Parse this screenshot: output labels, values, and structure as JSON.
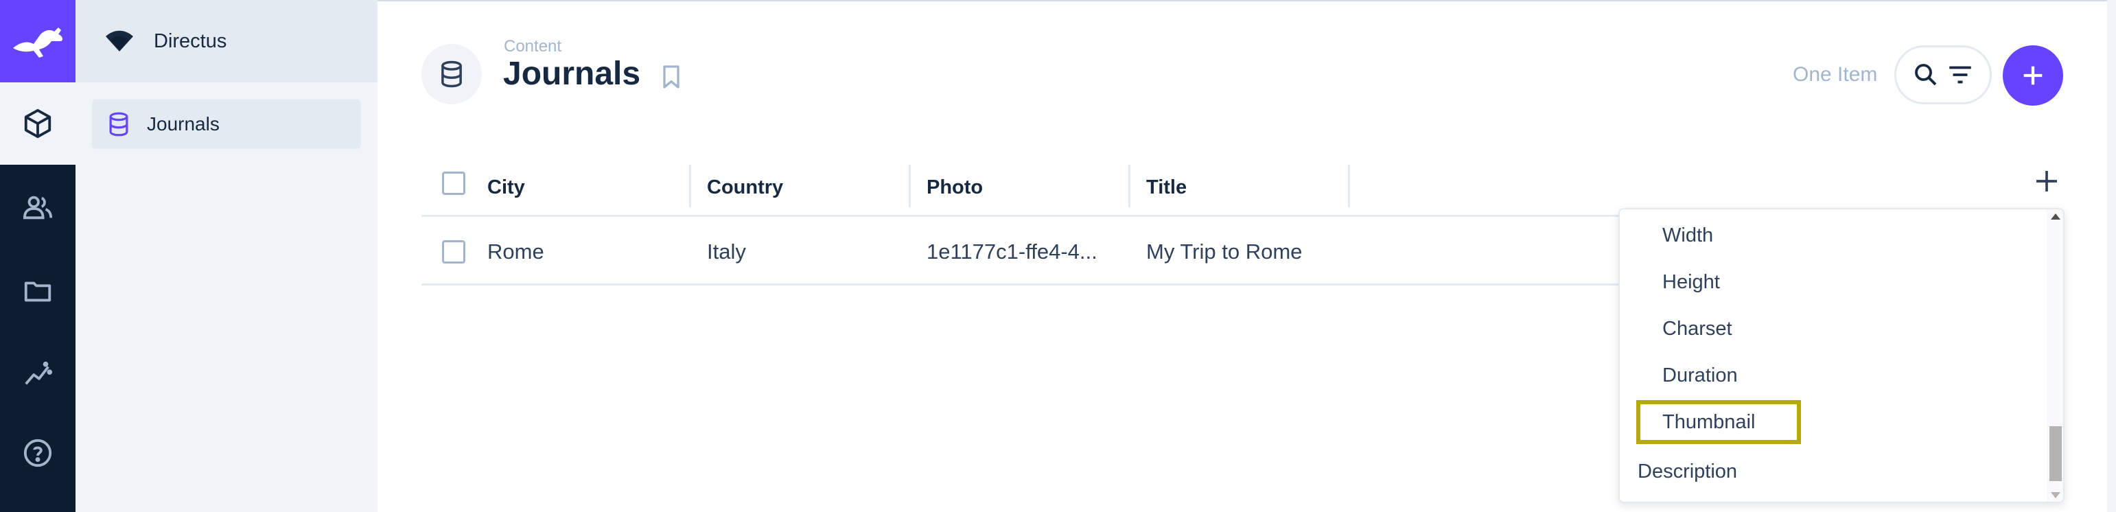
{
  "module_bar": {
    "items": [
      {
        "icon": "cube-icon",
        "active": true
      },
      {
        "icon": "users-icon",
        "active": false
      },
      {
        "icon": "folder-icon",
        "active": false
      },
      {
        "icon": "insights-icon",
        "active": false
      },
      {
        "icon": "help-icon",
        "active": false
      }
    ]
  },
  "nav": {
    "project_name": "Directus",
    "items": [
      {
        "label": "Journals",
        "icon": "database-icon"
      }
    ]
  },
  "header": {
    "breadcrumb": "Content",
    "title": "Journals",
    "item_count": "One Item"
  },
  "table": {
    "columns": [
      "City",
      "Country",
      "Photo",
      "Title"
    ],
    "rows": [
      [
        "Rome",
        "Italy",
        "1e1177c1-ffe4-4...",
        "My Trip to Rome"
      ]
    ]
  },
  "dropdown": {
    "items": [
      "Width",
      "Height",
      "Charset",
      "Duration",
      "Thumbnail",
      "Description"
    ],
    "highlighted": "Thumbnail"
  },
  "colors": {
    "accent": "#6644ff",
    "module_bar_bg": "#0e1c2f",
    "nav_bg": "#f0f4f9",
    "highlight_border": "#b6a90d"
  }
}
